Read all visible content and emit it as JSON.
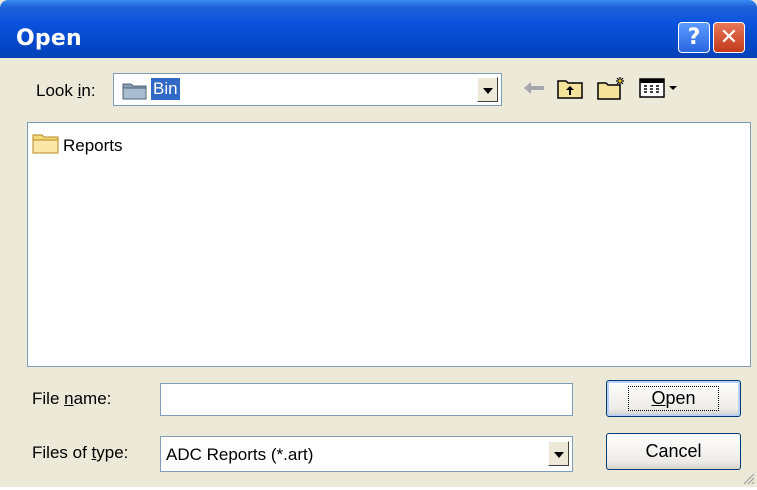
{
  "window": {
    "title": "Open",
    "help_glyph": "?",
    "close_glyph": "✕"
  },
  "lookin": {
    "label_pre": "Look ",
    "label_u": "i",
    "label_post": "n:",
    "value": "Bin",
    "icon": "folder-icon"
  },
  "toolbar": {
    "icons": [
      "back-arrow-icon",
      "up-folder-icon",
      "new-folder-icon",
      "view-menu-icon"
    ]
  },
  "files": [
    {
      "name": "Reports",
      "icon": "folder-icon"
    }
  ],
  "filename": {
    "label_pre": "File ",
    "label_u": "n",
    "label_post": "ame:",
    "value": ""
  },
  "filetype": {
    "label_pre": "Files of ",
    "label_u": "t",
    "label_post": "ype:",
    "value": "ADC Reports (*.art)"
  },
  "buttons": {
    "open_u": "O",
    "open_rest": "pen",
    "cancel": "Cancel"
  },
  "colors": {
    "titlebar": "#0A52DE",
    "face": "#ECE9D8",
    "selection": "#316AC5",
    "border": "#7F9DB9"
  }
}
